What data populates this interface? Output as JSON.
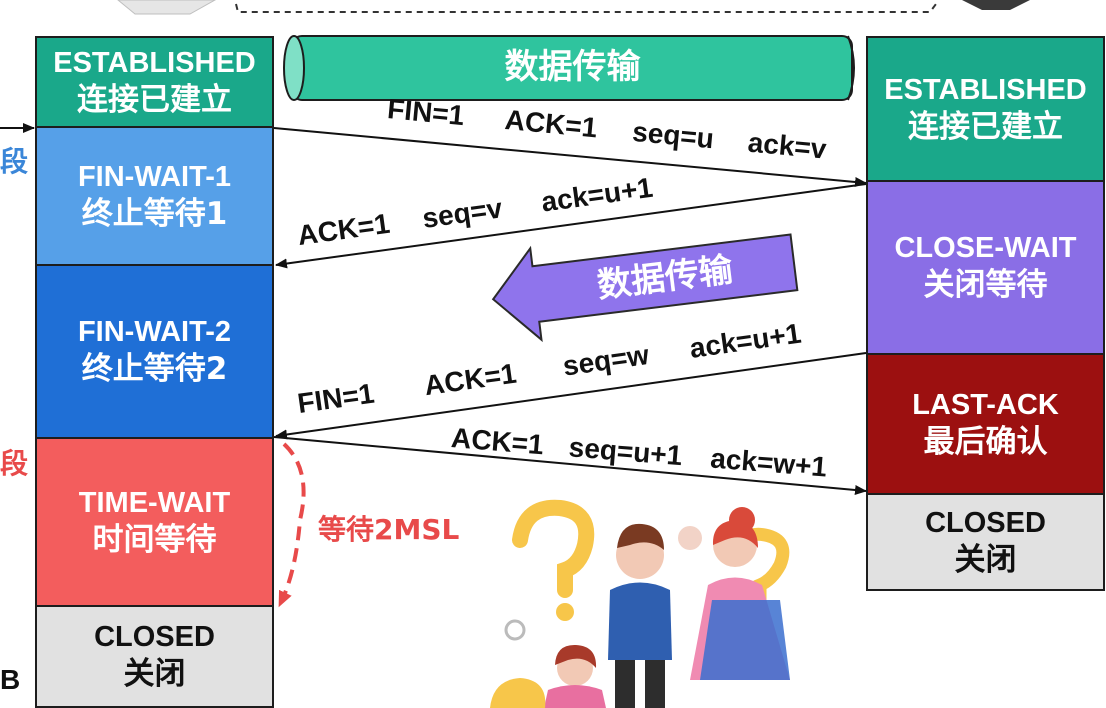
{
  "left_column": [
    {
      "en": "ESTABLISHED",
      "zh": "连接已建立",
      "color": "#1aa88a"
    },
    {
      "en": "FIN-WAIT-1",
      "zh": "终止等待1",
      "color": "#56a0e8"
    },
    {
      "en": "FIN-WAIT-2",
      "zh": "终止等待2",
      "color": "#1f6fd6"
    },
    {
      "en": "TIME-WAIT",
      "zh": "时间等待",
      "color": "#f35d5d"
    },
    {
      "en": "CLOSED",
      "zh": "关闭",
      "color": "#e1e1e1"
    }
  ],
  "right_column": [
    {
      "en": "ESTABLISHED",
      "zh": "连接已建立",
      "color": "#1aa88a"
    },
    {
      "en": "CLOSE-WAIT",
      "zh": "关闭等待",
      "color": "#8a6ee6"
    },
    {
      "en": "LAST-ACK",
      "zh": "最后确认",
      "color": "#9c1010"
    },
    {
      "en": "CLOSED",
      "zh": "关闭",
      "color": "#e1e1e1"
    }
  ],
  "edge_labels": {
    "duan_1": "段",
    "duan_2": "段",
    "b": "B"
  },
  "transfer_tube": {
    "label": "数据传输",
    "color": "#2fc49e"
  },
  "transfer_arrow": {
    "label": "数据传输",
    "color": "#8f74ec"
  },
  "messages": [
    {
      "fields": [
        "FIN=1",
        "ACK=1",
        "seq=u",
        "ack=v"
      ]
    },
    {
      "fields": [
        "ACK=1",
        "seq=v",
        "ack=u+1"
      ]
    },
    {
      "fields": [
        "FIN=1",
        "ACK=1",
        "seq=w",
        "ack=u+1"
      ]
    },
    {
      "fields": [
        "ACK=1",
        "seq=u+1",
        "ack=w+1"
      ]
    }
  ],
  "wait_label": "等待2MSL",
  "accent_colors": {
    "wait": "#e84a4a",
    "edge_blue": "#3a86d8",
    "edge_red": "#e84a4a"
  }
}
